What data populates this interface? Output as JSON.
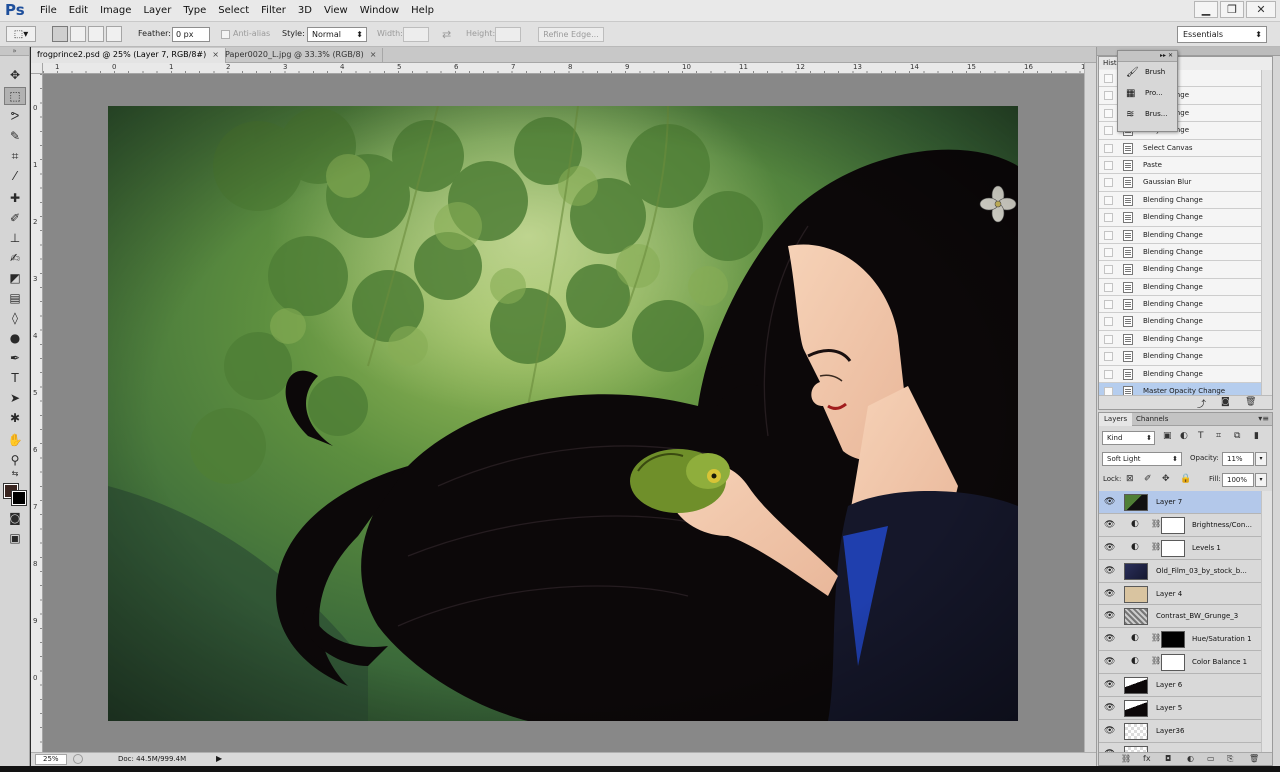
{
  "app": {
    "logo": "Ps"
  },
  "menu": [
    "File",
    "Edit",
    "Image",
    "Layer",
    "Type",
    "Select",
    "Filter",
    "3D",
    "View",
    "Window",
    "Help"
  ],
  "window_controls": {
    "minimize": "▁",
    "restore": "❐",
    "close": "✕"
  },
  "options": {
    "feather_label": "Feather:",
    "feather_value": "0 px",
    "antialias_label": "Anti-alias",
    "style_label": "Style:",
    "style_value": "Normal",
    "width_label": "Width:",
    "height_label": "Height:",
    "refine_edge": "Refine Edge...",
    "workspace": "Essentials"
  },
  "tabs": [
    {
      "label": "frogprince2.psd @ 25% (Layer 7, RGB/8#)",
      "close": "×"
    },
    {
      "label": "Paper0020_L.jpg @ 33.3% (RGB/8)",
      "close": "×"
    }
  ],
  "ruler": {
    "horizontal": [
      "1",
      "0",
      "1",
      "2",
      "3",
      "4",
      "5",
      "6",
      "7",
      "8",
      "9",
      "10",
      "11",
      "12",
      "13",
      "14",
      "15",
      "16",
      "1"
    ],
    "vertical": [
      "0",
      "1",
      "2",
      "3",
      "4",
      "5",
      "6",
      "7",
      "8",
      "9",
      "0"
    ]
  },
  "status": {
    "zoom": "25%",
    "doc": "Doc: 44.5M/999.4M",
    "arrow": "▶"
  },
  "history": {
    "tab": "Hist",
    "items": [
      "hange",
      "acity Change",
      "acity Change",
      "acity Change",
      "Select Canvas",
      "Paste",
      "Gaussian Blur",
      "Blending Change",
      "Blending Change",
      "Blending Change",
      "Blending Change",
      "Blending Change",
      "Blending Change",
      "Blending Change",
      "Blending Change",
      "Blending Change",
      "Blending Change",
      "Blending Change",
      "Master Opacity Change"
    ],
    "selected_index": 18
  },
  "flyout": {
    "items": [
      "Brush",
      "Pro...",
      "Brus..."
    ]
  },
  "layers_panel": {
    "tabs": [
      "Layers",
      "Channels"
    ],
    "kind": "Kind",
    "blend_mode": "Soft Light",
    "opacity_label": "Opacity:",
    "opacity_value": "11%",
    "lock_label": "Lock:",
    "fill_label": "Fill:",
    "fill_value": "100%",
    "layers": [
      {
        "name": "Layer 7",
        "type": "pixel",
        "thumb": "art",
        "selected": true
      },
      {
        "name": "Brightness/Con...",
        "type": "adjustment",
        "thumb": "white"
      },
      {
        "name": "Levels 1",
        "type": "adjustment",
        "thumb": "white"
      },
      {
        "name": "Old_Film_03_by_stock_b...",
        "type": "pixel",
        "thumb": "dark-blue"
      },
      {
        "name": "Layer 4",
        "type": "pixel",
        "thumb": "tan"
      },
      {
        "name": "Contrast_BW_Grunge_3",
        "type": "pixel",
        "thumb": "grunge"
      },
      {
        "name": "Hue/Saturation 1",
        "type": "adjustment",
        "thumb": "black"
      },
      {
        "name": "Color Balance 1",
        "type": "adjustment",
        "thumb": "white"
      },
      {
        "name": "Layer 6",
        "type": "pixel",
        "thumb": "hair"
      },
      {
        "name": "Layer 5",
        "type": "pixel",
        "thumb": "hair"
      },
      {
        "name": "Layer36",
        "type": "pixel",
        "thumb": "transparent"
      },
      {
        "name": "",
        "type": "pixel",
        "thumb": "transparent"
      }
    ]
  },
  "colors": {
    "foreground": "#3a2520",
    "background": "#000000",
    "selection": "#b3c8ea",
    "history_selection": "#b5cdee",
    "canvas_bg": "#888888"
  }
}
